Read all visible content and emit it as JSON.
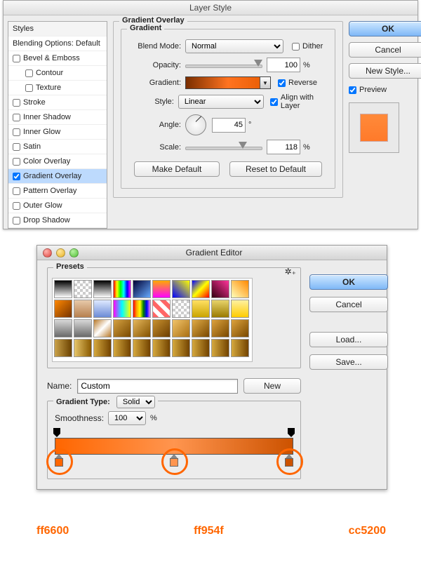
{
  "window1": {
    "title": "Layer Style",
    "sidebar": {
      "header": "Styles",
      "blending": "Blending Options: Default",
      "items": [
        {
          "label": "Bevel & Emboss",
          "checked": false,
          "indent": false
        },
        {
          "label": "Contour",
          "checked": false,
          "indent": true
        },
        {
          "label": "Texture",
          "checked": false,
          "indent": true
        },
        {
          "label": "Stroke",
          "checked": false,
          "indent": false
        },
        {
          "label": "Inner Shadow",
          "checked": false,
          "indent": false
        },
        {
          "label": "Inner Glow",
          "checked": false,
          "indent": false
        },
        {
          "label": "Satin",
          "checked": false,
          "indent": false
        },
        {
          "label": "Color Overlay",
          "checked": false,
          "indent": false
        },
        {
          "label": "Gradient Overlay",
          "checked": true,
          "indent": false,
          "selected": true
        },
        {
          "label": "Pattern Overlay",
          "checked": false,
          "indent": false
        },
        {
          "label": "Outer Glow",
          "checked": false,
          "indent": false
        },
        {
          "label": "Drop Shadow",
          "checked": false,
          "indent": false
        }
      ]
    },
    "overlay": {
      "section_title": "Gradient Overlay",
      "sub_title": "Gradient",
      "blend_mode_label": "Blend Mode:",
      "blend_mode_value": "Normal",
      "dither_label": "Dither",
      "dither_checked": false,
      "opacity_label": "Opacity:",
      "opacity_value": "100",
      "opacity_unit": "%",
      "gradient_label": "Gradient:",
      "reverse_label": "Reverse",
      "reverse_checked": true,
      "style_label": "Style:",
      "style_value": "Linear",
      "align_label": "Align with Layer",
      "align_checked": true,
      "angle_label": "Angle:",
      "angle_value": "45",
      "angle_unit": "°",
      "scale_label": "Scale:",
      "scale_value": "118",
      "scale_unit": "%",
      "make_default": "Make Default",
      "reset_default": "Reset to Default"
    },
    "buttons": {
      "ok": "OK",
      "cancel": "Cancel",
      "new_style": "New Style...",
      "preview": "Preview",
      "preview_checked": true
    }
  },
  "window2": {
    "title": "Gradient Editor",
    "presets_label": "Presets",
    "buttons": {
      "ok": "OK",
      "cancel": "Cancel",
      "load": "Load...",
      "save": "Save...",
      "new": "New"
    },
    "name_label": "Name:",
    "name_value": "Custom",
    "gradient_type_label": "Gradient Type:",
    "gradient_type_value": "Solid",
    "smoothness_label": "Smoothness:",
    "smoothness_value": "100",
    "smoothness_unit": "%",
    "stops": [
      {
        "pos": 0,
        "color": "#ff6600",
        "label": "ff6600"
      },
      {
        "pos": 50,
        "color": "#ff954f",
        "label": "ff954f"
      },
      {
        "pos": 100,
        "color": "#cc5200",
        "label": "cc5200"
      }
    ],
    "preset_thumbs": [
      "linear-gradient(#000,#fff)",
      "repeating-conic-gradient(#ccc 0 25%,#fff 0 50%) 0/8px 8px",
      "linear-gradient(#000,#fff)",
      "linear-gradient(90deg,#f00,#ff0,#0f0,#0ff,#00f,#f0f)",
      "linear-gradient(135deg,#003,#6af)",
      "linear-gradient(#fa0,#f0f)",
      "linear-gradient(45deg,#00f,#ff0)",
      "linear-gradient(135deg,#00f,#ff0,#f00)",
      "linear-gradient(45deg,#301,#f39)",
      "linear-gradient(45deg,#ffb,#f80)",
      "linear-gradient(135deg,#f80,#730)",
      "linear-gradient(#e7c9a9,#b7804f)",
      "linear-gradient(#dfe9ff,#6b8bd6)",
      "linear-gradient(90deg,#f0f,#0ff,#ff0)",
      "linear-gradient(90deg,red,orange,yellow,green,blue,violet)",
      "repeating-linear-gradient(45deg,#f66 0 6px,#fff 6px 12px)",
      "repeating-conic-gradient(#ccc 0 25%,#fff 0 50%) 0/8px 8px",
      "linear-gradient(#ffe063,#caa400)",
      "linear-gradient(#e7d36a,#9a7a00)",
      "linear-gradient(#fff1a0,#ffcc00)",
      "linear-gradient(#d8d8d8,#6a6a6a)",
      "linear-gradient(#d8d8d8,#6a6a6a)",
      "linear-gradient(135deg,#b97a2a,#fff,#b97a2a)",
      "linear-gradient(135deg,#d4a040,#7a4a00)",
      "linear-gradient(135deg,#e5b65a,#835200)",
      "linear-gradient(135deg,#c8912f,#6d3e00)",
      "linear-gradient(135deg,#f1c36a,#a96f12)",
      "linear-gradient(135deg,#e0aa45,#7a4900)",
      "linear-gradient(135deg,#dca23c,#7a4900)",
      "linear-gradient(135deg,#dca23c,#7a4900)",
      "linear-gradient(90deg,#caa24a,#6b4200)",
      "linear-gradient(90deg,#e6c56a,#8a5a00)",
      "linear-gradient(90deg,#d5a83e,#734400)",
      "linear-gradient(90deg,#d5a83e,#734400)",
      "linear-gradient(90deg,#d5a83e,#734400)",
      "linear-gradient(90deg,#d5a83e,#734400)",
      "linear-gradient(90deg,#d5a83e,#734400)",
      "linear-gradient(90deg,#d5a83e,#734400)",
      "linear-gradient(90deg,#d5a83e,#734400)",
      "linear-gradient(90deg,#d5a83e,#734400)"
    ]
  }
}
